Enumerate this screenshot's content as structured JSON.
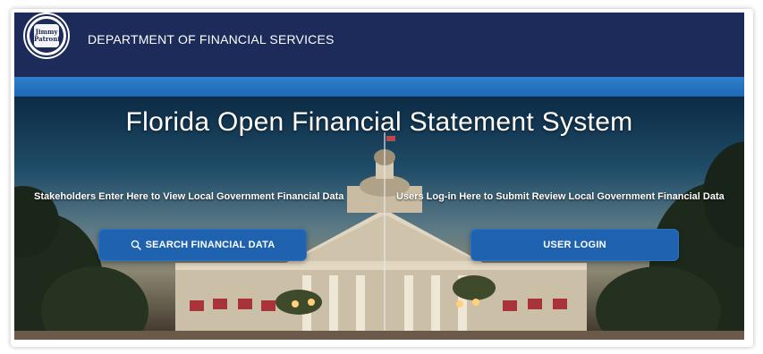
{
  "header": {
    "department_title": "DEPARTMENT OF FINANCIAL SERVICES",
    "seal_name": "Jimmy Patronis",
    "seal_icon": "cfo-seal-icon",
    "background_color": "#1c2b5a"
  },
  "stripe": {
    "color": "#2f7fcc"
  },
  "hero": {
    "title": "Florida Open Financial Statement System",
    "left_caption": "Stakeholders Enter Here to View Local Government Financial Data",
    "right_caption": "Users Log-in Here to Submit Review Local Government Financial Data",
    "search_button": {
      "label": "SEARCH FINANCIAL DATA",
      "icon": "search-icon"
    },
    "login_button": {
      "label": "USER LOGIN"
    },
    "button_color": "#1f63b0"
  }
}
